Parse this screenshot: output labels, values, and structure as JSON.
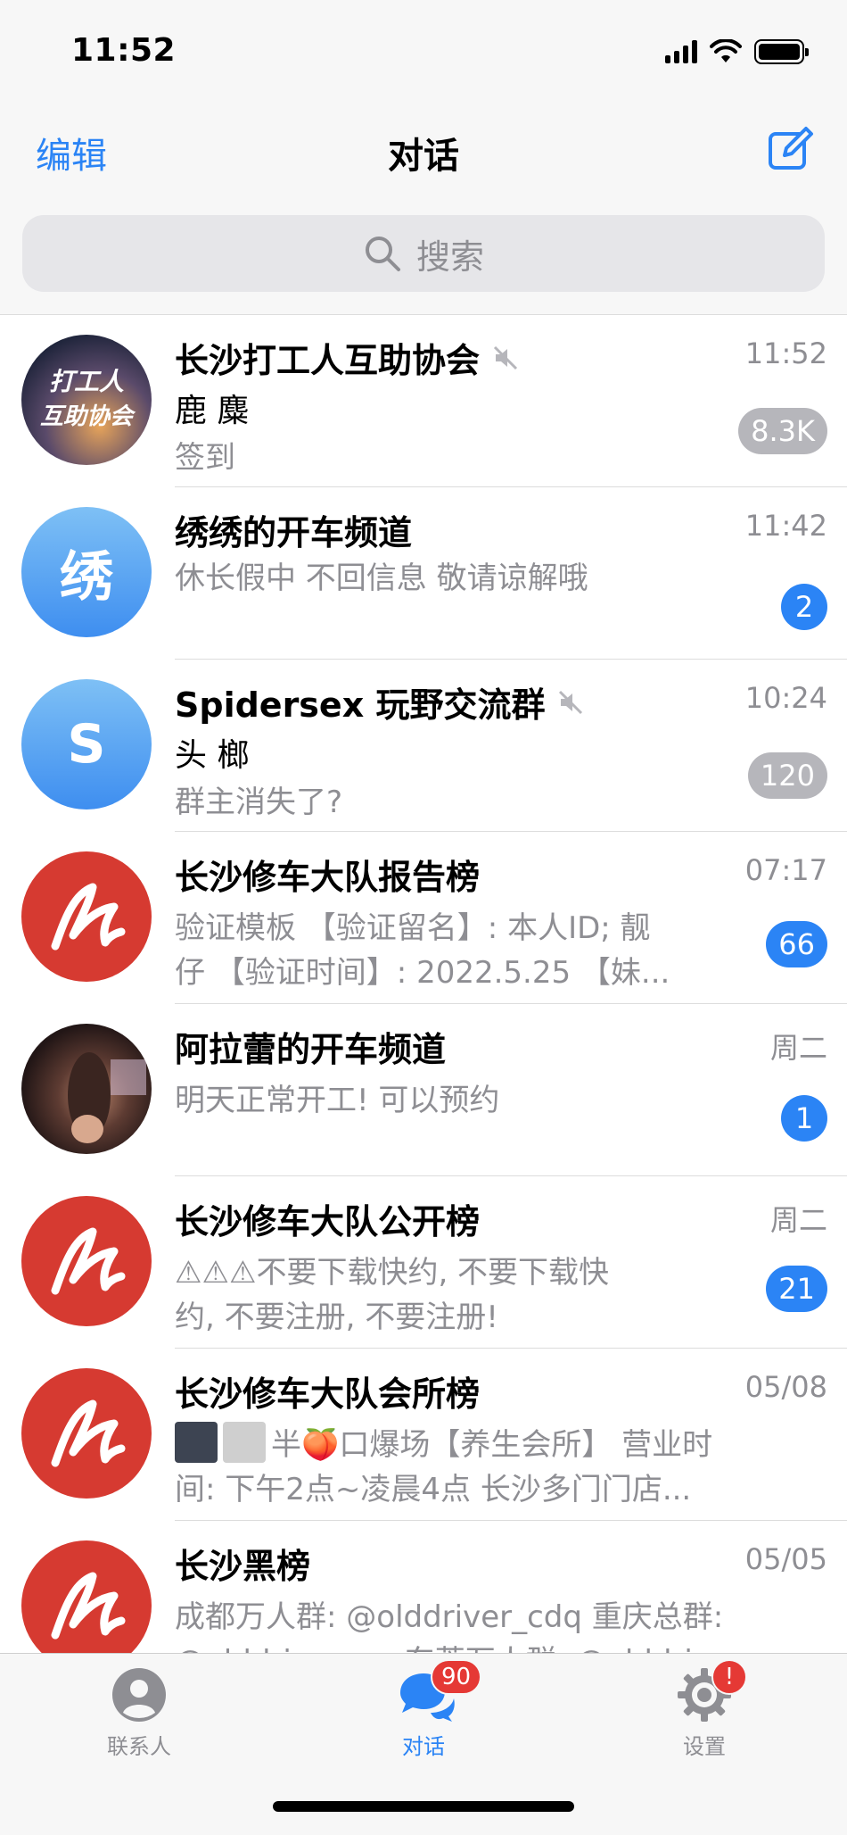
{
  "status_bar": {
    "time": "11:52"
  },
  "nav": {
    "edit_label": "编辑",
    "title": "对话",
    "compose_icon": "compose-icon"
  },
  "search": {
    "placeholder": "搜索",
    "icon": "search-icon"
  },
  "chats": [
    {
      "title": "长沙打工人互助协会",
      "muted": true,
      "time": "11:52",
      "sender": "鹿 麋",
      "message": "签到",
      "badge": "8.3K",
      "badge_style": "muted",
      "avatar_text": "打工人 互助协会"
    },
    {
      "title": "绣绣的开车频道",
      "muted": false,
      "time": "11:42",
      "message": "休长假中  不回信息 敬请谅解哦",
      "badge": "2",
      "badge_style": "blue",
      "avatar_text": "绣"
    },
    {
      "title": "Spidersex 玩野交流群",
      "muted": true,
      "time": "10:24",
      "sender": "头 榔",
      "message": "群主消失了?",
      "badge": "120",
      "badge_style": "muted",
      "avatar_text": "S"
    },
    {
      "title": "长沙修车大队报告榜",
      "muted": false,
      "time": "07:17",
      "message_line1": "验证模板 【验证留名】: 本人ID; 靓",
      "message_line2": "仔 【验证时间】: 2022.5.25 【妹...",
      "badge": "66",
      "badge_style": "blue"
    },
    {
      "title": "阿拉蕾的开车频道",
      "muted": false,
      "time": "周二",
      "message": "明天正常开工! 可以预约",
      "badge": "1",
      "badge_style": "blue"
    },
    {
      "title": "长沙修车大队公开榜",
      "muted": false,
      "time": "周二",
      "message_line1": "⚠⚠⚠不要下载快约, 不要下载快",
      "message_line2": "约, 不要注册, 不要注册!",
      "badge": "21",
      "badge_style": "blue"
    },
    {
      "title": "长沙修车大队会所榜",
      "muted": false,
      "time": "05/08",
      "message_line1": "半🍑口爆场【养生会所】 营业时",
      "message_line2": "间: 下午2点~凌晨4点 长沙多门门店..."
    },
    {
      "title": "长沙黑榜",
      "muted": false,
      "time": "05/05",
      "message_line1": "成都万人群: @olddriver_cdq 重庆总群:",
      "message_line2": "@olddrivercqq 东莞万人群: @olddrive..."
    }
  ],
  "tabbar": {
    "contacts_label": "联系人",
    "chats_label": "对话",
    "chats_badge": "90",
    "settings_label": "设置",
    "settings_badge": "!",
    "active": "chats"
  },
  "colors": {
    "accent": "#2b84f5",
    "muted_badge": "#b6b6bb",
    "alert": "#e53935",
    "logo_red": "#d63a31"
  }
}
